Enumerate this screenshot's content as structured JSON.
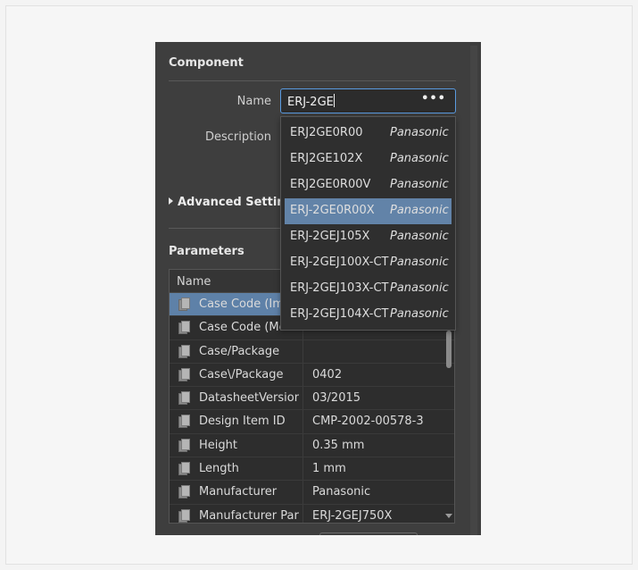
{
  "component": {
    "title": "Component",
    "name_label": "Name",
    "name_value": "ERJ-2GE",
    "browse_label": "•••",
    "description_label": "Description",
    "advanced_label": "Advanced Settings"
  },
  "parameters": {
    "title": "Parameters",
    "column_name": "Name",
    "rows": [
      {
        "name": "Case Code (Imperial)",
        "value": "",
        "selected": true
      },
      {
        "name": "Case Code (Metric)",
        "value": ""
      },
      {
        "name": "Case/Package",
        "value": ""
      },
      {
        "name": "Case\\/Package",
        "value": "0402"
      },
      {
        "name": "DatasheetVersion",
        "value": "03/2015"
      },
      {
        "name": "Design Item ID",
        "value": "CMP-2002-00578-3"
      },
      {
        "name": "Height",
        "value": "0.35 mm"
      },
      {
        "name": "Length",
        "value": "1 mm"
      },
      {
        "name": "Manufacturer",
        "value": "Panasonic"
      },
      {
        "name": "Manufacturer Part Number",
        "value": "ERJ-2GEJ750X"
      }
    ]
  },
  "suggestions": [
    {
      "part": "ERJ2GE0R00",
      "mfr": "Panasonic"
    },
    {
      "part": "ERJ2GE102X",
      "mfr": "Panasonic"
    },
    {
      "part": "ERJ2GE0R00V",
      "mfr": "Panasonic"
    },
    {
      "part": "ERJ-2GE0R00X",
      "mfr": "Panasonic",
      "highlighted": true
    },
    {
      "part": "ERJ-2GEJ105X",
      "mfr": "Panasonic"
    },
    {
      "part": "ERJ-2GEJ100X-CT",
      "mfr": "Panasonic"
    },
    {
      "part": "ERJ-2GEJ103X-CT",
      "mfr": "Panasonic"
    },
    {
      "part": "ERJ-2GEJ104X-CT",
      "mfr": "Panasonic"
    }
  ],
  "icons": {
    "parameter": "document-stack-icon"
  },
  "colors": {
    "panel_bg": "#3e3e3e",
    "selection": "#5e81a8",
    "focus_border": "#5a9be0"
  }
}
